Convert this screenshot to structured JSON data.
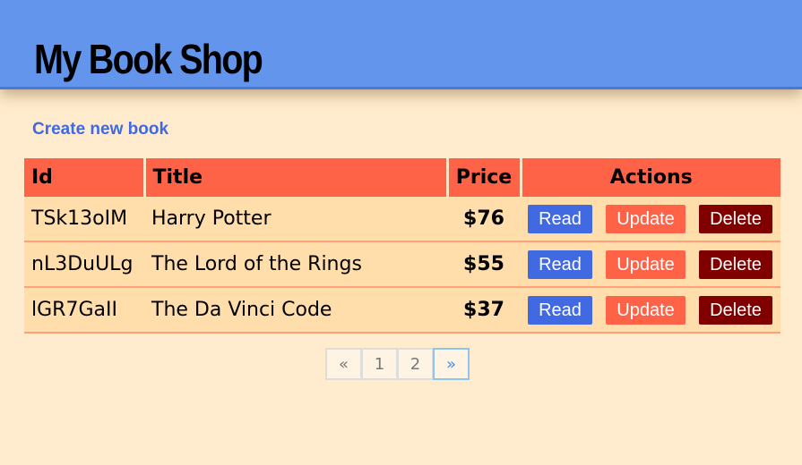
{
  "app": {
    "title": "My Book Shop"
  },
  "actions": {
    "create_link": "Create new book"
  },
  "table": {
    "headers": {
      "id": "Id",
      "title": "Title",
      "price": "Price",
      "actions": "Actions"
    },
    "rows": [
      {
        "id": "TSk13oIM",
        "title": "Harry Potter",
        "price": "$76"
      },
      {
        "id": "nL3DuULg",
        "title": "The Lord of the Rings",
        "price": "$55"
      },
      {
        "id": "lGR7GaII",
        "title": "The Da Vinci Code",
        "price": "$37"
      }
    ],
    "buttons": {
      "read": "Read",
      "update": "Update",
      "delete": "Delete"
    }
  },
  "pagination": {
    "prev": "«",
    "pages": [
      "1",
      "2"
    ],
    "next": "»"
  },
  "colors": {
    "header": "#6495ed",
    "background": "#ffebcd",
    "table_header": "#ff6347",
    "row": "#ffdeac",
    "read": "#4169e1",
    "update": "#ff6347",
    "delete": "#800000"
  }
}
